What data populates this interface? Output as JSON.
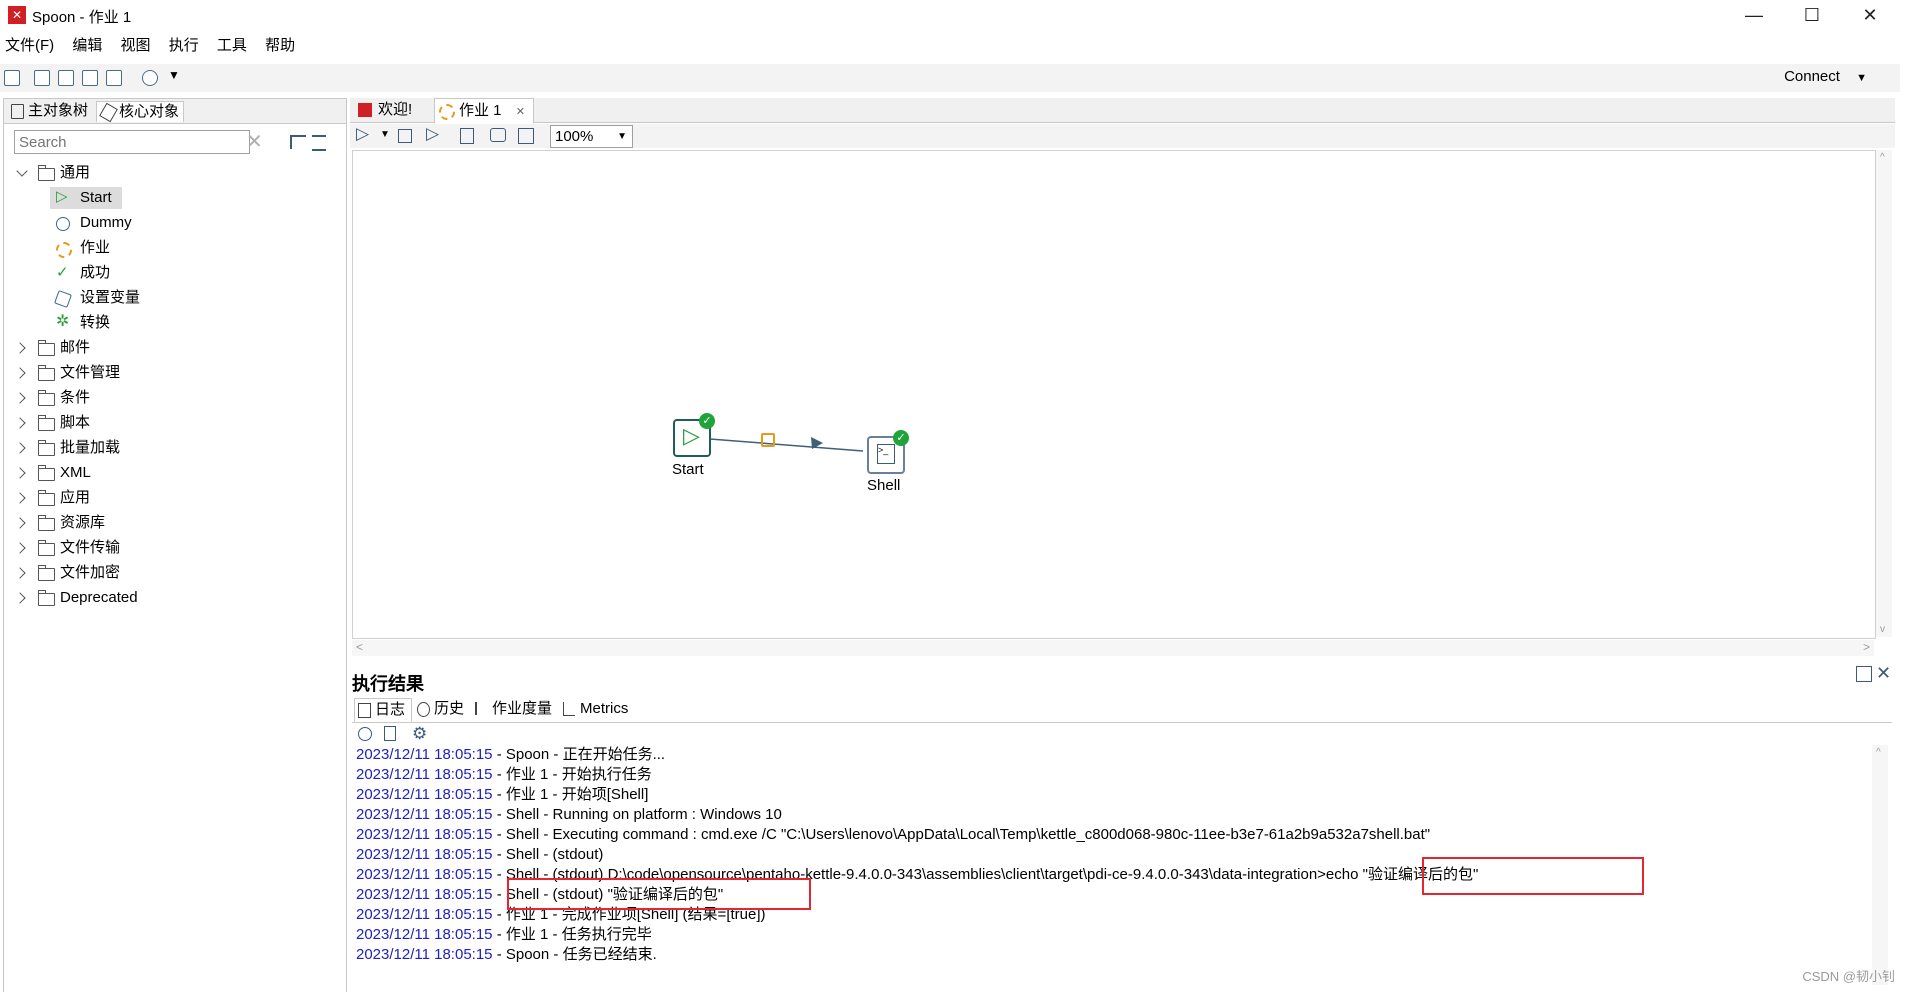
{
  "window": {
    "title": "Spoon - 作业 1",
    "logo_text": "✕"
  },
  "menubar": [
    "文件(F)",
    "编辑",
    "视图",
    "执行",
    "工具",
    "帮助"
  ],
  "toolbar": {
    "connect_label": "Connect"
  },
  "left_panel": {
    "tabs": [
      "主对象树",
      "核心对象"
    ],
    "search_placeholder": "Search",
    "tree": {
      "expanded_folder": "通用",
      "children": [
        "Start",
        "Dummy",
        "作业",
        "成功",
        "设置变量",
        "转换"
      ],
      "folders": [
        "邮件",
        "文件管理",
        "条件",
        "脚本",
        "批量加载",
        "XML",
        "应用",
        "资源库",
        "文件传输",
        "文件加密",
        "Deprecated"
      ]
    }
  },
  "editor": {
    "tabs": [
      "欢迎!",
      "作业 1"
    ],
    "zoom": "100%",
    "nodes": {
      "start": "Start",
      "shell": "Shell"
    }
  },
  "results": {
    "title": "执行结果",
    "tabs": [
      "日志",
      "历史",
      "作业度量",
      "Metrics"
    ],
    "log": [
      {
        "ts": "2023/12/11 18:05:15",
        "msg": " - Spoon - 正在开始任务..."
      },
      {
        "ts": "2023/12/11 18:05:15",
        "msg": " - 作业 1 - 开始执行任务"
      },
      {
        "ts": "2023/12/11 18:05:15",
        "msg": " - 作业 1 - 开始项[Shell]"
      },
      {
        "ts": "2023/12/11 18:05:15",
        "msg": " - Shell - Running on platform : Windows 10"
      },
      {
        "ts": "2023/12/11 18:05:15",
        "msg": " - Shell - Executing command : cmd.exe /C \"C:\\Users\\lenovo\\AppData\\Local\\Temp\\kettle_c800d068-980c-11ee-b3e7-61a2b9a532a7shell.bat\""
      },
      {
        "ts": "2023/12/11 18:05:15",
        "msg": " - Shell - (stdout)"
      },
      {
        "ts": "2023/12/11 18:05:15",
        "msg": " - Shell - (stdout) D:\\code\\opensource\\pentaho-kettle-9.4.0.0-343\\assemblies\\client\\target\\pdi-ce-9.4.0.0-343\\data-integration>echo \"验证编译后的包\""
      },
      {
        "ts": "2023/12/11 18:05:15",
        "msg": " - Shell - (stdout) \"验证编译后的包\""
      },
      {
        "ts": "2023/12/11 18:05:15",
        "msg": " - 作业 1 - 完成作业项[Shell] (结果=[true])"
      },
      {
        "ts": "2023/12/11 18:05:15",
        "msg": " - 作业 1 - 任务执行完毕"
      },
      {
        "ts": "2023/12/11 18:05:15",
        "msg": " - Spoon - 任务已经结束."
      }
    ]
  },
  "watermark": "CSDN @韧小钊",
  "colors": {
    "timestamp": "#2020c0",
    "highlight_box": "#e3262f",
    "ok_badge": "#1fa33b"
  }
}
